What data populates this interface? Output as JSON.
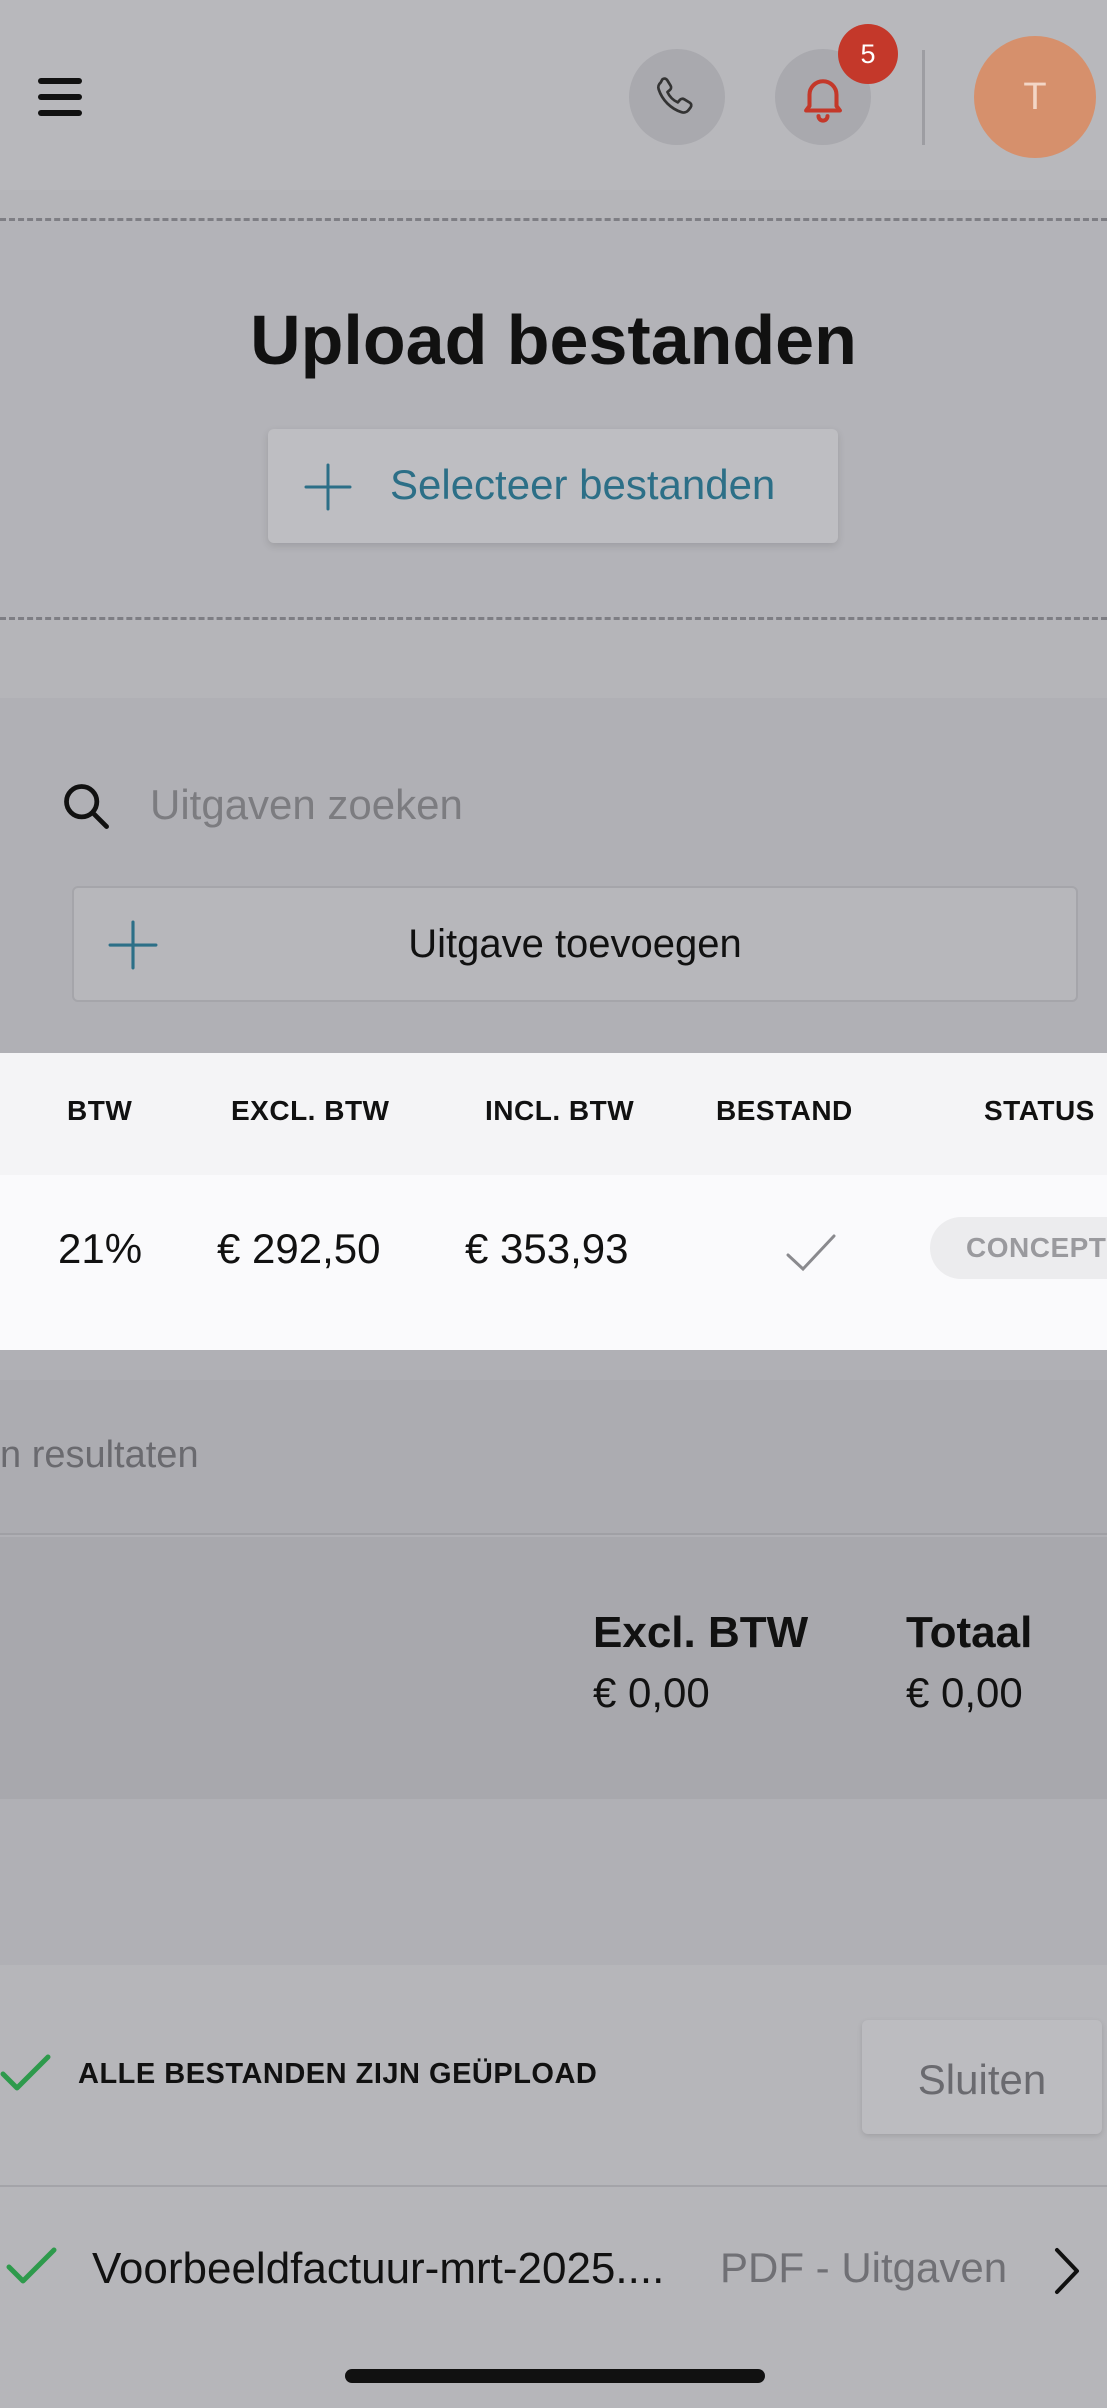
{
  "header": {
    "menu_icon": "hamburger-menu-icon",
    "phone_icon": "phone-icon",
    "bell_icon": "bell-icon",
    "notification_count": "5",
    "avatar_initial": "T",
    "avatar_color": "#d6906c",
    "badge_color": "#c4382a"
  },
  "upload": {
    "title": "Upload bestanden",
    "select_label": "Selecteer bestanden",
    "accent_color": "#2c6f87"
  },
  "expenses": {
    "search_placeholder": "Uitgaven zoeken",
    "add_label": "Uitgave toevoegen",
    "columns": [
      "BTW",
      "EXCL. BTW",
      "INCL. BTW",
      "BESTAND",
      "STATUS"
    ],
    "rows": [
      {
        "btw": "21%",
        "excl": "€ 292,50",
        "incl": "€ 353,93",
        "bestand": "check-icon",
        "status": "CONCEPT"
      }
    ],
    "results_text": "n resultaten",
    "totals": {
      "excl_label": "Excl. BTW",
      "excl_value": "€ 0,00",
      "total_label": "Totaal",
      "total_value": "€ 0,00"
    }
  },
  "upload_status": {
    "message": "ALLE BESTANDEN ZIJN GEÜPLOAD",
    "close_label": "Sluiten",
    "success_color": "#2e9a4c",
    "files": [
      {
        "name": "Voorbeeldfactuur-mrt-2025....",
        "meta": "PDF - Uitgaven"
      }
    ]
  }
}
